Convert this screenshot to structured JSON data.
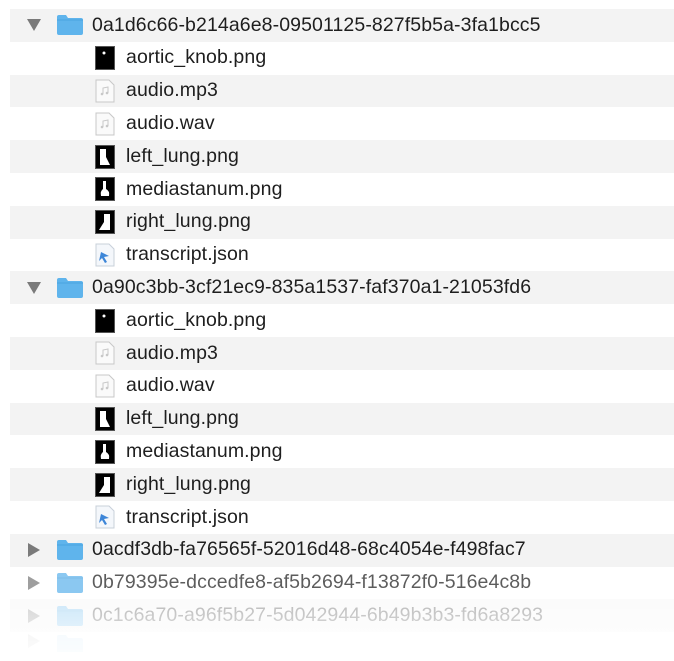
{
  "tree": [
    {
      "kind": "folder",
      "expanded": true,
      "name": "0a1d6c66-b214a6e8-09501125-827f5b5a-3fa1bcc5",
      "children": [
        {
          "name": "aortic_knob.png",
          "icon": "aortic-knob-image-icon"
        },
        {
          "name": "audio.mp3",
          "icon": "audio-file-icon"
        },
        {
          "name": "audio.wav",
          "icon": "audio-file-icon"
        },
        {
          "name": "left_lung.png",
          "icon": "left-lung-image-icon"
        },
        {
          "name": "mediastanum.png",
          "icon": "mediastinum-image-icon"
        },
        {
          "name": "right_lung.png",
          "icon": "right-lung-image-icon"
        },
        {
          "name": "transcript.json",
          "icon": "json-file-icon"
        }
      ]
    },
    {
      "kind": "folder",
      "expanded": true,
      "name": "0a90c3bb-3cf21ec9-835a1537-faf370a1-21053fd6",
      "children": [
        {
          "name": "aortic_knob.png",
          "icon": "aortic-knob-image-icon"
        },
        {
          "name": "audio.mp3",
          "icon": "audio-file-icon"
        },
        {
          "name": "audio.wav",
          "icon": "audio-file-icon"
        },
        {
          "name": "left_lung.png",
          "icon": "left-lung-image-icon"
        },
        {
          "name": "mediastanum.png",
          "icon": "mediastinum-image-icon"
        },
        {
          "name": "right_lung.png",
          "icon": "right-lung-image-icon"
        },
        {
          "name": "transcript.json",
          "icon": "json-file-icon"
        }
      ]
    },
    {
      "kind": "folder",
      "expanded": false,
      "name": "0acdf3db-fa76565f-52016d48-68c4054e-f498fac7"
    },
    {
      "kind": "folder",
      "expanded": false,
      "name": "0b79395e-dccedfe8-af5b2694-f13872f0-516e4c8b"
    },
    {
      "kind": "folder",
      "expanded": false,
      "name": "0c1c6a70-a96f5b27-5d042944-6b49b3b3-fd6a8293"
    }
  ],
  "colors": {
    "folder": "#5fb4ec",
    "folder_tab": "#4aa4df",
    "text": "#1e1e1e",
    "alt_row": "#f3f3f3",
    "disclosure": "#7a7a7a"
  }
}
